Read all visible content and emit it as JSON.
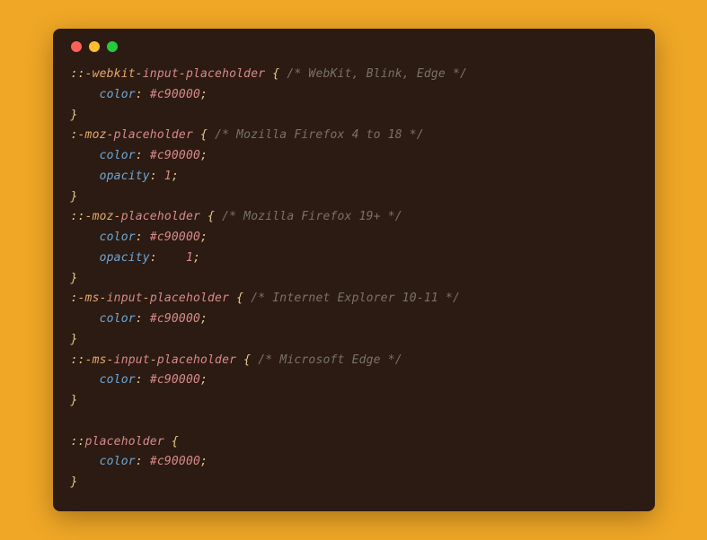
{
  "window": {
    "dots": {
      "red": "#ff5f56",
      "yellow": "#ffbd2e",
      "green": "#27c93f"
    }
  },
  "code": {
    "rules": [
      {
        "selector": {
          "colon": "::",
          "prefix": "-webkit-",
          "parts": [
            "input",
            "placeholder"
          ]
        },
        "comment": "/* WebKit, Blink, Edge */",
        "decls": [
          {
            "prop": "color",
            "val": "#c90000",
            "gap": " "
          }
        ]
      },
      {
        "selector": {
          "colon": ":",
          "prefix": "-moz-",
          "parts": [
            "placeholder"
          ]
        },
        "comment": "/* Mozilla Firefox 4 to 18 */",
        "decls": [
          {
            "prop": "color",
            "val": "#c90000",
            "gap": " "
          },
          {
            "prop": "opacity",
            "val": "1",
            "isNum": true,
            "gap": " "
          }
        ]
      },
      {
        "selector": {
          "colon": "::",
          "prefix": "-moz-",
          "parts": [
            "placeholder"
          ]
        },
        "comment": "/* Mozilla Firefox 19+ */",
        "decls": [
          {
            "prop": "color",
            "val": "#c90000",
            "gap": " "
          },
          {
            "prop": "opacity",
            "val": "1",
            "isNum": true,
            "gap": "    "
          }
        ]
      },
      {
        "selector": {
          "colon": ":",
          "prefix": "-ms-",
          "parts": [
            "input",
            "placeholder"
          ]
        },
        "comment": "/* Internet Explorer 10-11 */",
        "decls": [
          {
            "prop": "color",
            "val": "#c90000",
            "gap": " "
          }
        ]
      },
      {
        "selector": {
          "colon": "::",
          "prefix": "-ms-",
          "parts": [
            "input",
            "placeholder"
          ]
        },
        "comment": "/* Microsoft Edge */",
        "decls": [
          {
            "prop": "color",
            "val": "#c90000",
            "gap": " "
          }
        ]
      },
      {
        "blankBefore": true,
        "selector": {
          "colon": "::",
          "prefix": "",
          "parts": [
            "placeholder"
          ]
        },
        "comment": "",
        "decls": [
          {
            "prop": "color",
            "val": "#c90000",
            "gap": " "
          }
        ]
      }
    ]
  }
}
